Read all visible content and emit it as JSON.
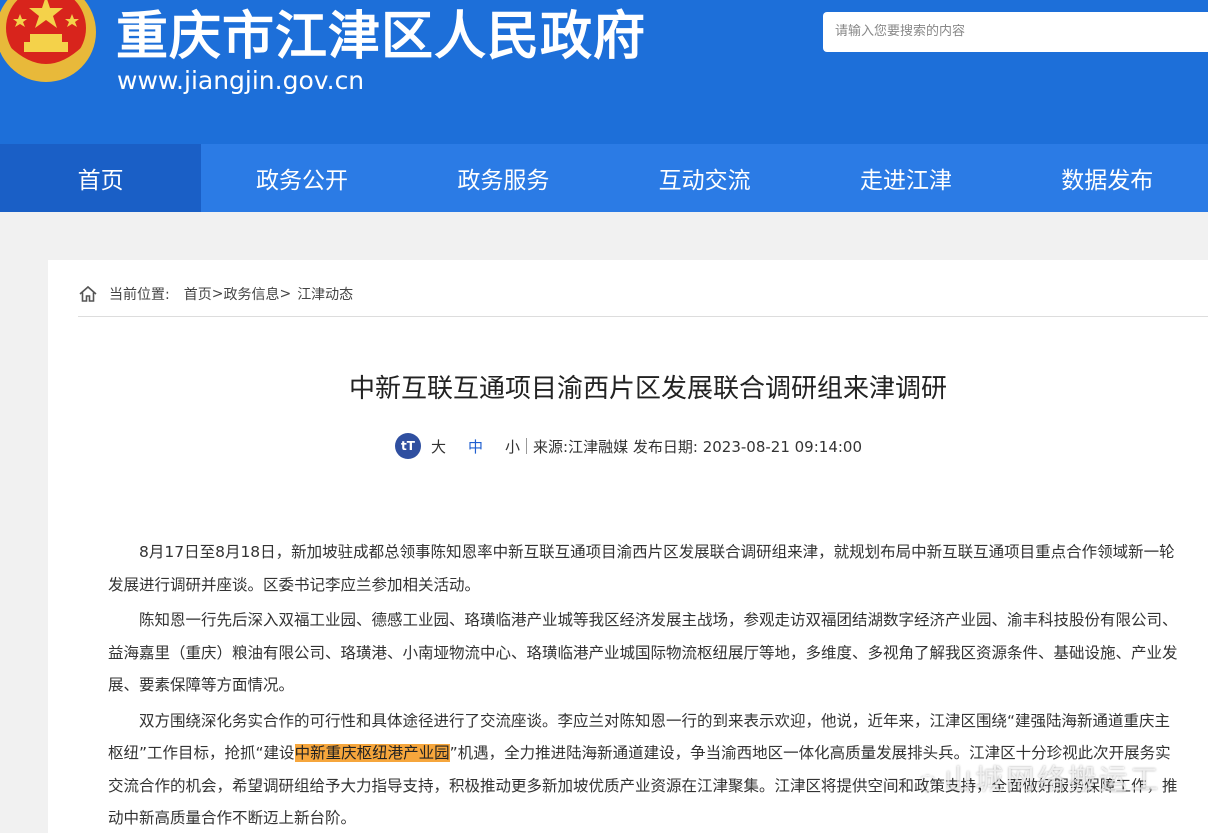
{
  "header": {
    "site_title": "重庆市江津区人民政府",
    "site_url": "www.jiangjin.gov.cn",
    "search_placeholder": "请输入您要搜索的内容"
  },
  "nav": {
    "items": [
      {
        "label": "首页"
      },
      {
        "label": "政务公开"
      },
      {
        "label": "政务服务"
      },
      {
        "label": "互动交流"
      },
      {
        "label": "走进江津"
      },
      {
        "label": "数据发布"
      }
    ]
  },
  "breadcrumb": {
    "prefix": "当前位置:",
    "home": "首页",
    "sep1": ">",
    "level1": "政务信息",
    "sep2": ">",
    "level2": "江津动态"
  },
  "article": {
    "title": "中新互联互通项目渝西片区发展联合调研组来津调研",
    "font_sizes": {
      "large": "大",
      "medium": "中",
      "small": "小"
    },
    "source": "来源:江津融媒 发布日期:  2023-08-21 09:14:00",
    "p1": "8月17日至8月18日，新加坡驻成都总领事陈知恩率中新互联互通项目渝西片区发展联合调研组来津，就规划布局中新互联互通项目重点合作领域新一轮发展进行调研并座谈。区委书记李应兰参加相关活动。",
    "p2": "陈知恩一行先后深入双福工业园、德感工业园、珞璜临港产业城等我区经济发展主战场，参观走访双福团结湖数字经济产业园、渝丰科技股份有限公司、益海嘉里（重庆）粮油有限公司、珞璜港、小南垭物流中心、珞璜临港产业城国际物流枢纽展厅等地，多维度、多视角了解我区资源条件、基础设施、产业发展、要素保障等方面情况。",
    "p3_a": "双方围绕深化务实合作的可行性和具体途径进行了交流座谈。李应兰对陈知恩一行的到来表示欢迎，他说，近年来，江津区围绕“建强陆海新通道重庆主枢纽”工作目标，抢抓“建设",
    "p3_highlight": "中新重庆枢纽港产业园",
    "p3_b": "”机遇，全力推进陆海新通道建设，争当渝西地区一体化高质量发展排头兵。江津区十分珍视此次开展务实交流合作的机会，希望调研组给予大力指导支持，积极推动更多新加坡优质产业资源在江津聚集。江津区将提供空间和政策支持，全面做好服务保障工作，推动中新高质量合作不断迈上新台阶。"
  },
  "watermark": {
    "text": "山城网络搬运工"
  },
  "colors": {
    "header_bg": "#1d6fd9",
    "nav_bg": "#2b7be5",
    "nav_active_bg": "#1a5fc6",
    "highlight": "#f6a63c"
  }
}
